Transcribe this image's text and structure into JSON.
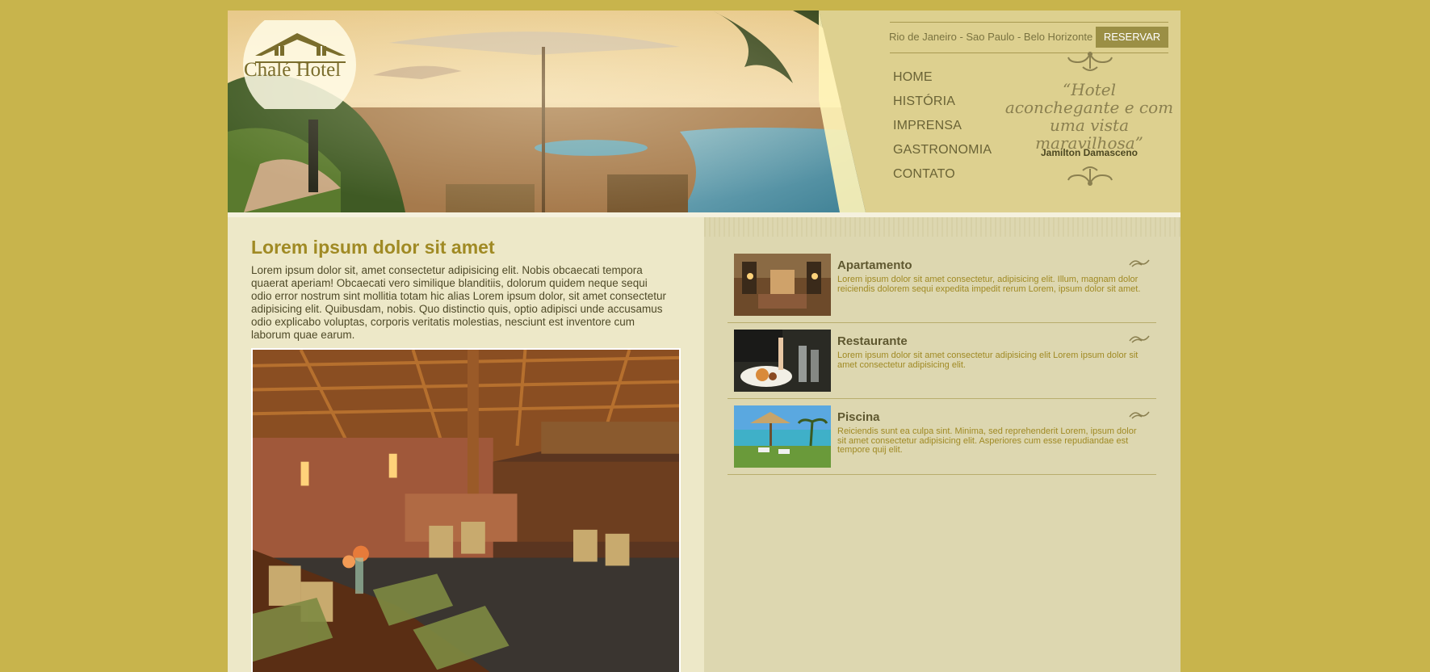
{
  "brand": {
    "name": "Chalé Hotel"
  },
  "header": {
    "cities": "Rio de Janeiro - Sao Paulo - Belo Horizonte",
    "reserve_label": "RESERVAR",
    "nav": [
      "HOME",
      "HISTÓRIA",
      "IMPRENSA",
      "GASTRONOMIA",
      "CONTATO"
    ],
    "quote": "“Hotel aconchegante e com uma vista maravilhosa”",
    "author": "Jamilton Damasceno"
  },
  "main": {
    "title": "Lorem ipsum dolor sit amet",
    "text": "Lorem ipsum dolor sit, amet consectetur adipisicing elit. Nobis obcaecati tempora quaerat aperiam! Obcaecati vero similique blanditiis, dolorum quidem neque sequi odio error nostrum sint mollitia totam hic alias Lorem ipsum dolor, sit amet consectetur adipisicing elit. Quibusdam, nobis. Quo distinctio quis, optio adipisci unde accusamus odio explicabo voluptas, corporis veritatis molestias, nesciunt est inventore cum laborum quae earum."
  },
  "sidebar": {
    "cards": [
      {
        "title": "Apartamento",
        "text": "Lorem ipsum dolor sit amet consectetur, adipisicing elit. Illum, magnam dolor reiciendis dolorem sequi expedita impedit rerum Lorem, ipsum dolor sit amet."
      },
      {
        "title": "Restaurante",
        "text": "Lorem ipsum dolor sit amet consectetur adipisicing elit Lorem ipsum dolor sit amet consectetur adipisicing elit."
      },
      {
        "title": "Piscina",
        "text": "Reiciendis sunt ea culpa sint. Minima, sed reprehenderit Lorem, ipsum dolor sit amet consectetur adipisicing elit. Asperiores cum esse repudiandae est tempore quij elit."
      }
    ]
  },
  "colors": {
    "background": "#c8b44c",
    "accent": "#a08a24",
    "button": "#9b8f45",
    "panel": "#ddd08f"
  }
}
